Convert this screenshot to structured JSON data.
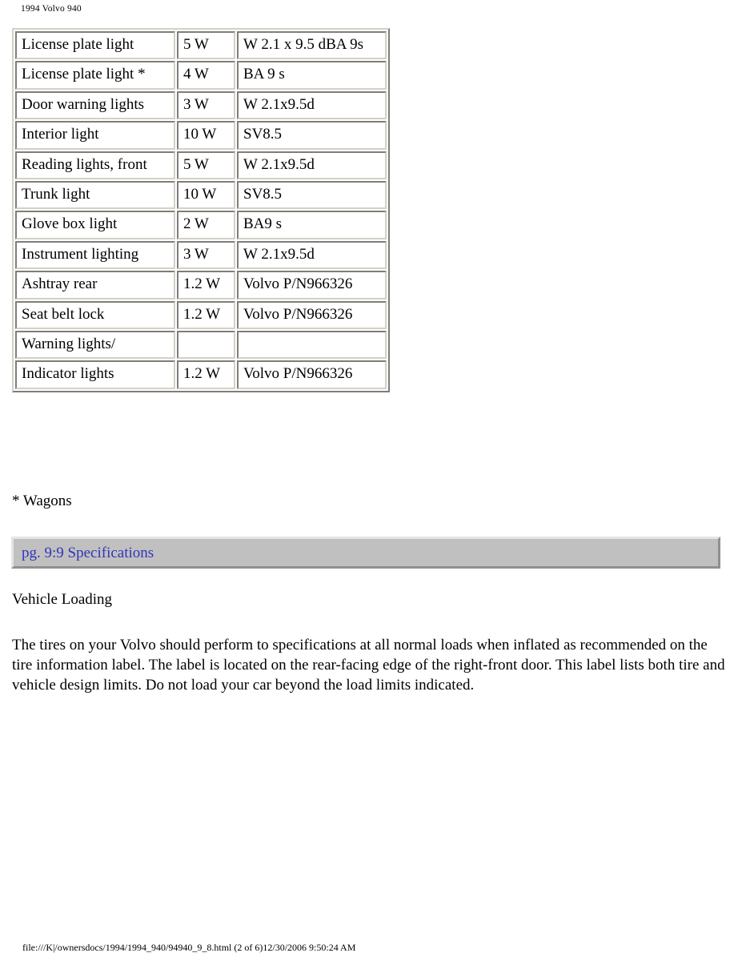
{
  "page_header": "1994 Volvo 940",
  "bulb_table": {
    "rows": [
      {
        "component": "License plate light",
        "wattage": "5 W",
        "type": "W 2.1 x 9.5 dBA 9s"
      },
      {
        "component": "License plate light *",
        "wattage": "4 W",
        "type": "BA 9 s"
      },
      {
        "component": "Door warning lights",
        "wattage": "3 W",
        "type": "W 2.1x9.5d"
      },
      {
        "component": "Interior light",
        "wattage": "10 W",
        "type": "SV8.5"
      },
      {
        "component": "Reading lights, front",
        "wattage": "5 W",
        "type": "W 2.1x9.5d"
      },
      {
        "component": "Trunk light",
        "wattage": "10 W",
        "type": "SV8.5"
      },
      {
        "component": "Glove box light",
        "wattage": "2 W",
        "type": "BA9 s"
      },
      {
        "component": "Instrument lighting",
        "wattage": "3 W",
        "type": "W 2.1x9.5d"
      },
      {
        "component": "Ashtray rear",
        "wattage": "1.2 W",
        "type": "Volvo P/N966326"
      },
      {
        "component": "Seat belt lock",
        "wattage": "1.2 W",
        "type": "Volvo P/N966326"
      },
      {
        "component": "Warning lights/",
        "wattage": "",
        "type": ""
      },
      {
        "component": "Indicator lights",
        "wattage": "1.2 W",
        "type": "Volvo P/N966326"
      }
    ]
  },
  "footnote": "* Wagons",
  "nav_bar": {
    "link_label": "pg. 9:9 Specifications",
    "background_color": "#c0c0c0",
    "link_color": "#3333bb"
  },
  "section_heading": "Vehicle Loading",
  "body_paragraph": "The tires on your Volvo should perform to specifications at all normal loads when inflated as recommended on the tire information label. The label is located on the rear-facing edge of the right-front door. This label lists both tire and vehicle design limits. Do not load your car beyond the load limits indicated.",
  "print_footer": "file:///K|/ownersdocs/1994/1994_940/94940_9_8.html (2 of 6)12/30/2006 9:50:24 AM"
}
